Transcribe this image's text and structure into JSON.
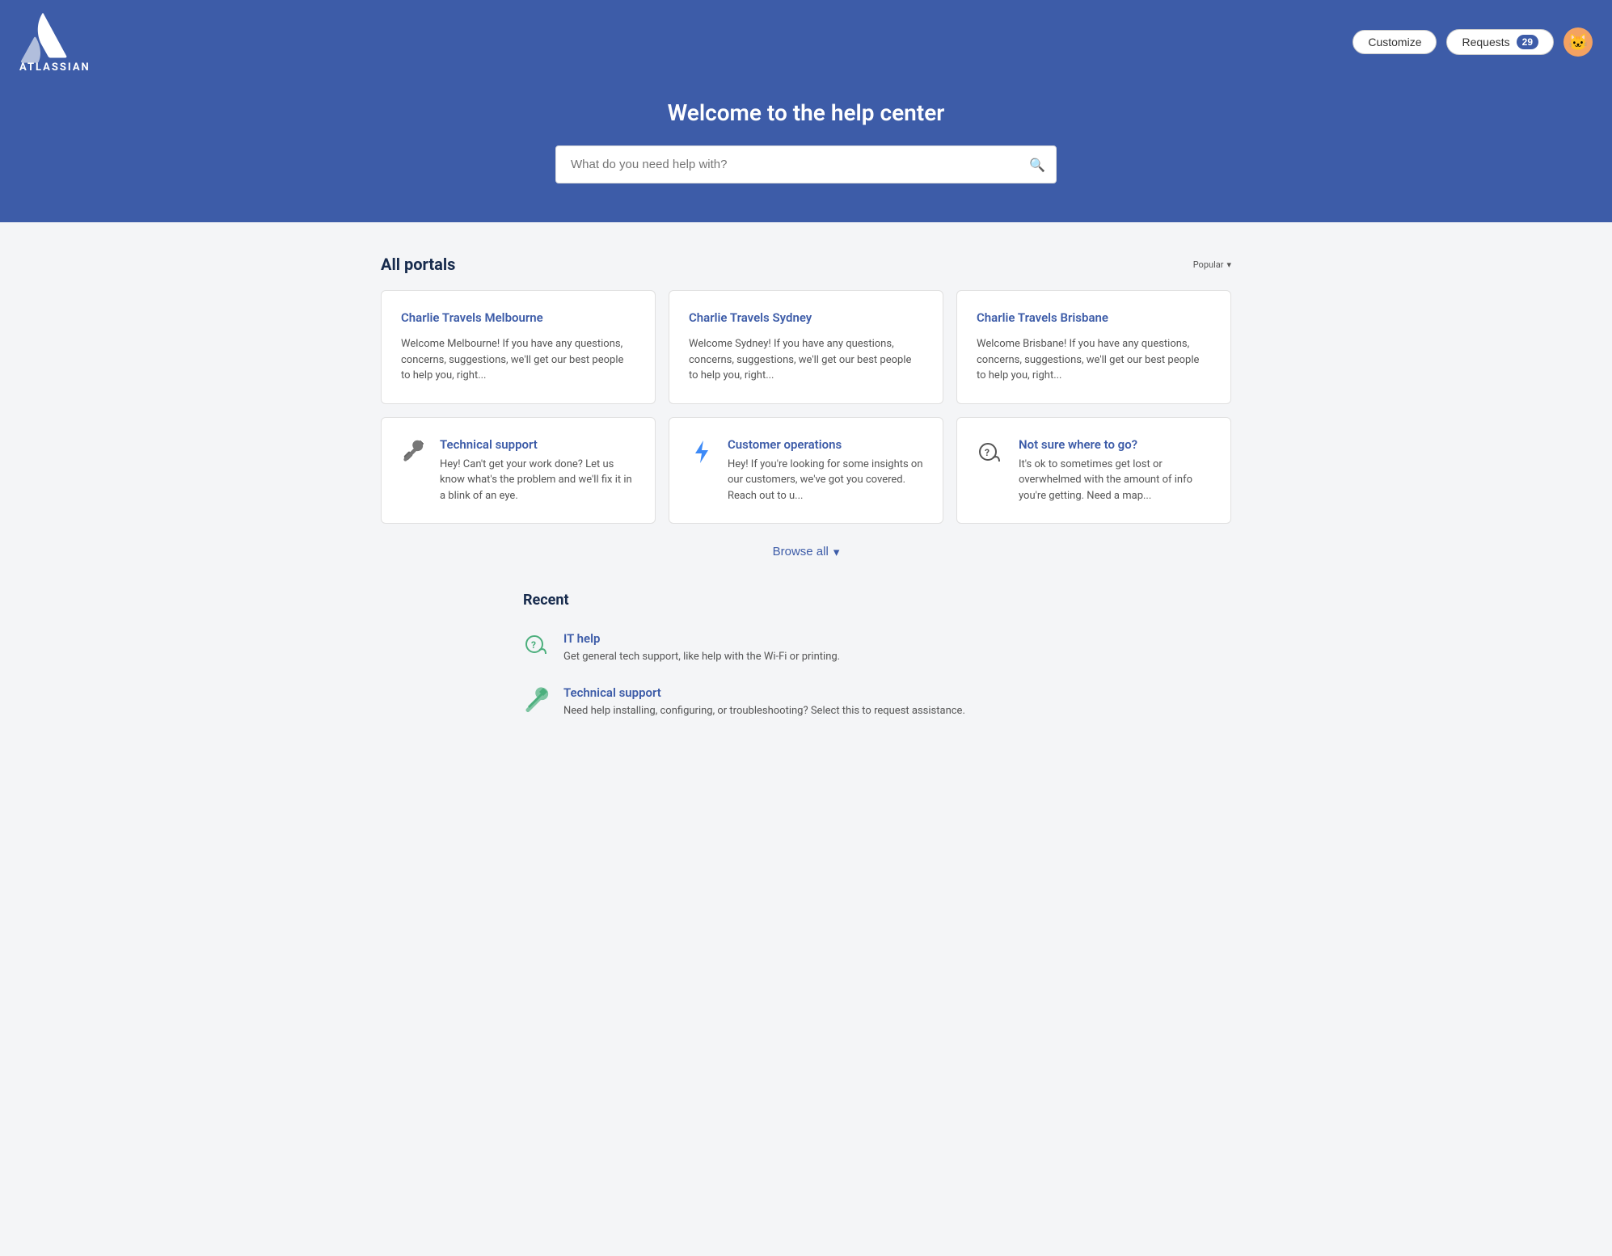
{
  "hero": {
    "title": "Welcome to the help center",
    "search_placeholder": "What do you need help with?"
  },
  "nav": {
    "customize_label": "Customize",
    "requests_label": "Requests",
    "requests_count": "29",
    "logo_text": "ATLASSIAN"
  },
  "portals_section": {
    "title": "All portals",
    "sort_label": "Popular",
    "portals": [
      {
        "name": "Charlie Travels Melbourne",
        "desc": "Welcome Melbourne! If you have any questions, concerns, suggestions, we'll get our best people to help you, right...",
        "has_icon": false,
        "icon": ""
      },
      {
        "name": "Charlie Travels Sydney",
        "desc": "Welcome Sydney! If you have any questions, concerns, suggestions, we'll get our best people to help you, right...",
        "has_icon": false,
        "icon": ""
      },
      {
        "name": "Charlie Travels Brisbane",
        "desc": "Welcome Brisbane! If you have any questions, concerns, suggestions, we'll get our best people to help you, right...",
        "has_icon": false,
        "icon": ""
      },
      {
        "name": "Technical support",
        "desc": "Hey! Can't get your work done? Let us know what's the problem and we'll fix it in a blink of an eye.",
        "has_icon": true,
        "icon": "🔧"
      },
      {
        "name": "Customer operations",
        "desc": "Hey! If you're looking for some insights on our customers, we've got you covered. Reach out to u...",
        "has_icon": true,
        "icon": "⚡"
      },
      {
        "name": "Not sure where to go?",
        "desc": "It's ok to sometimes get lost or overwhelmed with the amount of info you're getting. Need a map...",
        "has_icon": true,
        "icon": "💬"
      }
    ]
  },
  "browse_all": {
    "label": "Browse all"
  },
  "recent_section": {
    "title": "Recent",
    "items": [
      {
        "name": "IT help",
        "desc": "Get general tech support, like help with the Wi-Fi or printing.",
        "icon": "💬"
      },
      {
        "name": "Technical support",
        "desc": "Need help installing, configuring, or troubleshooting? Select this to request assistance.",
        "icon": "🔧"
      }
    ]
  }
}
